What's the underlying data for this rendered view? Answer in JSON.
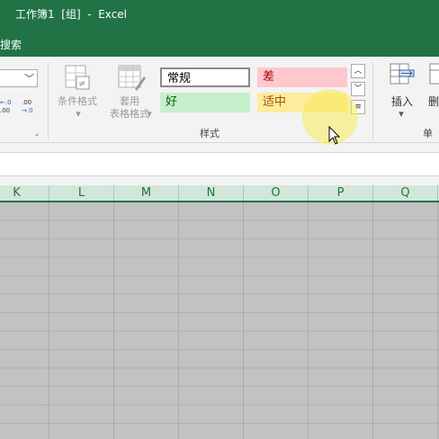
{
  "window": {
    "title": "工作簿1  [组]  -  Excel"
  },
  "tabs": {
    "search": "搜索"
  },
  "ribbon": {
    "conditional_format": "条件格式",
    "table_format_line1": "套用",
    "table_format_line2": "表格格式",
    "styles_group_label": "样式",
    "cells_group_label": "单元",
    "insert_label": "插入",
    "delete_label_partial": "删",
    "styles": {
      "normal": "常规",
      "bad": "差",
      "good": "好",
      "neutral": "适中"
    },
    "style_colors": {
      "bad_bg": "#ffc7ce",
      "bad_fg": "#9c0006",
      "good_bg": "#c6efce",
      "good_fg": "#006100",
      "neutral_bg": "#ffeb9c",
      "neutral_fg": "#9c5700"
    }
  },
  "sheet": {
    "columns": [
      "K",
      "L",
      "M",
      "N",
      "O",
      "P",
      "Q"
    ],
    "accent": "#217346"
  }
}
